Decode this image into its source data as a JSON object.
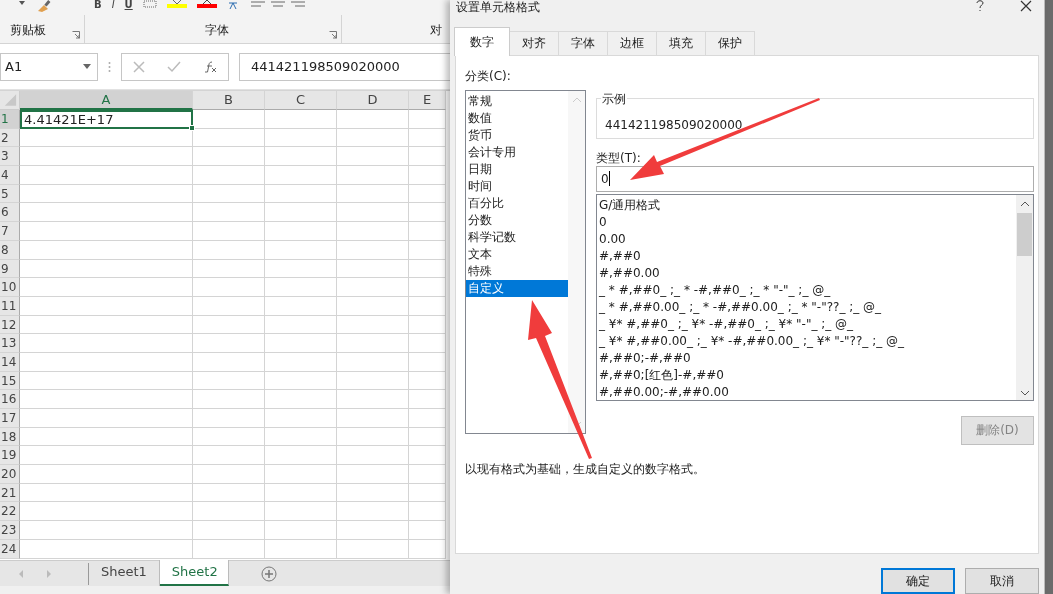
{
  "ribbon": {
    "groups": [
      {
        "label": "剪贴板"
      },
      {
        "label": "字体"
      },
      {
        "label": "对"
      }
    ],
    "font_buttons": [
      "B",
      "I",
      "U"
    ]
  },
  "formula_bar": {
    "name_box": "A1",
    "formula": "441421198509020000"
  },
  "sheet": {
    "columns": [
      {
        "label": "A",
        "selected": true
      },
      {
        "label": "B",
        "selected": false
      },
      {
        "label": "C",
        "selected": false
      },
      {
        "label": "D",
        "selected": false
      },
      {
        "label": "E",
        "selected": false
      }
    ],
    "rows": [
      {
        "header": "1",
        "selected": true,
        "cells": [
          "4.41421E+17"
        ]
      },
      {
        "header": "2",
        "selected": false,
        "cells": []
      },
      {
        "header": "3",
        "selected": false,
        "cells": []
      },
      {
        "header": "4",
        "selected": false,
        "cells": []
      },
      {
        "header": "5",
        "selected": false,
        "cells": []
      },
      {
        "header": "6",
        "selected": false,
        "cells": []
      },
      {
        "header": "7",
        "selected": false,
        "cells": []
      },
      {
        "header": "8",
        "selected": false,
        "cells": []
      },
      {
        "header": "9",
        "selected": false,
        "cells": []
      },
      {
        "header": "10",
        "selected": false,
        "cells": []
      },
      {
        "header": "11",
        "selected": false,
        "cells": []
      },
      {
        "header": "12",
        "selected": false,
        "cells": []
      },
      {
        "header": "13",
        "selected": false,
        "cells": []
      },
      {
        "header": "14",
        "selected": false,
        "cells": []
      },
      {
        "header": "15",
        "selected": false,
        "cells": []
      },
      {
        "header": "16",
        "selected": false,
        "cells": []
      },
      {
        "header": "17",
        "selected": false,
        "cells": []
      },
      {
        "header": "18",
        "selected": false,
        "cells": []
      },
      {
        "header": "19",
        "selected": false,
        "cells": []
      },
      {
        "header": "20",
        "selected": false,
        "cells": []
      },
      {
        "header": "21",
        "selected": false,
        "cells": []
      },
      {
        "header": "22",
        "selected": false,
        "cells": []
      },
      {
        "header": "23",
        "selected": false,
        "cells": []
      },
      {
        "header": "24",
        "selected": false,
        "cells": []
      }
    ]
  },
  "sheet_tabs": [
    {
      "label": "Sheet1",
      "selected": false
    },
    {
      "label": "Sheet2",
      "selected": true
    }
  ],
  "dialog": {
    "title": "设置单元格格式",
    "tabs": [
      {
        "label": "数字",
        "selected": true
      },
      {
        "label": "对齐",
        "selected": false
      },
      {
        "label": "字体",
        "selected": false
      },
      {
        "label": "边框",
        "selected": false
      },
      {
        "label": "填充",
        "selected": false
      },
      {
        "label": "保护",
        "selected": false
      }
    ],
    "category_label": "分类(C):",
    "categories": [
      {
        "label": "常规",
        "selected": false
      },
      {
        "label": "数值",
        "selected": false
      },
      {
        "label": "货币",
        "selected": false
      },
      {
        "label": "会计专用",
        "selected": false
      },
      {
        "label": "日期",
        "selected": false
      },
      {
        "label": "时间",
        "selected": false
      },
      {
        "label": "百分比",
        "selected": false
      },
      {
        "label": "分数",
        "selected": false
      },
      {
        "label": "科学记数",
        "selected": false
      },
      {
        "label": "文本",
        "selected": false
      },
      {
        "label": "特殊",
        "selected": false
      },
      {
        "label": "自定义",
        "selected": true
      }
    ],
    "sample": {
      "legend": "示例",
      "value": "441421198509020000"
    },
    "type_label": "类型(T):",
    "type_value": "0",
    "formats": [
      {
        "label": "G/通用格式",
        "selected": false
      },
      {
        "label": "0",
        "selected": false
      },
      {
        "label": "0.00",
        "selected": false
      },
      {
        "label": "#,##0",
        "selected": false
      },
      {
        "label": "#,##0.00",
        "selected": false
      },
      {
        "label": "_ * #,##0_ ;_ * -#,##0_ ;_ * \"-\"_ ;_ @_",
        "selected": false
      },
      {
        "label": "_ * #,##0.00_ ;_ * -#,##0.00_ ;_ * \"-\"??_ ;_ @_",
        "selected": false
      },
      {
        "label": "_ ¥* #,##0_ ;_ ¥* -#,##0_ ;_ ¥* \"-\"_ ;_ @_",
        "selected": false
      },
      {
        "label": "_ ¥* #,##0.00_ ;_ ¥* -#,##0.00_ ;_ ¥* \"-\"??_ ;_ @_",
        "selected": false
      },
      {
        "label": "#,##0;-#,##0",
        "selected": false
      },
      {
        "label": "#,##0;[红色]-#,##0",
        "selected": false
      },
      {
        "label": "#,##0.00;-#,##0.00",
        "selected": false
      }
    ],
    "delete_button": {
      "label": "删除(D)",
      "disabled": true
    },
    "description": "以现有格式为基础，生成自定义的数字格式。",
    "buttons": [
      {
        "label": "确定",
        "default": true
      },
      {
        "label": "取消",
        "default": false
      }
    ]
  }
}
